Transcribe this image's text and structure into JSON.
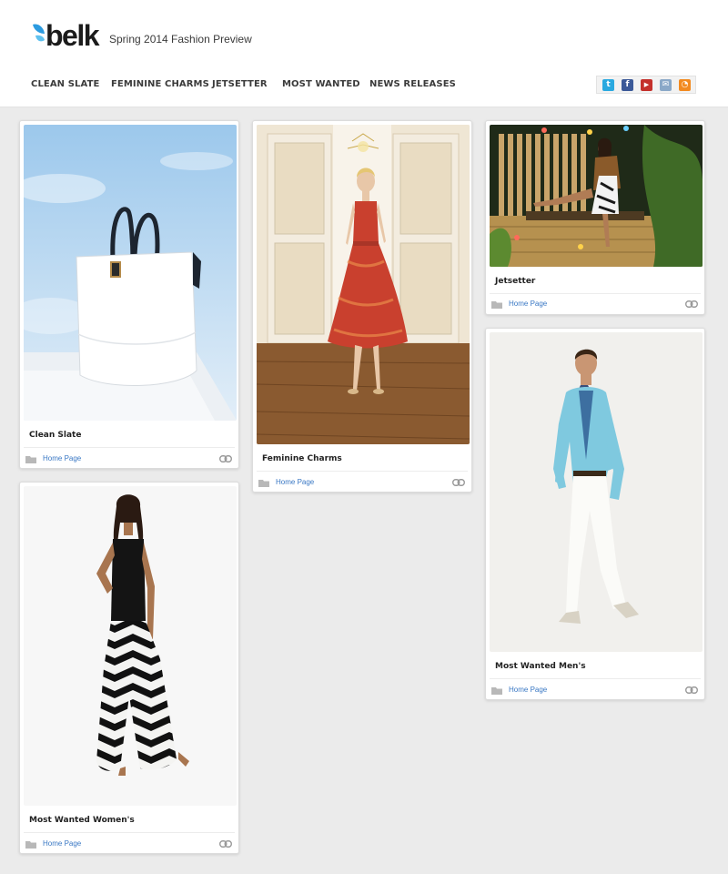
{
  "brand": {
    "logo_text": "belk",
    "tagline": "Spring 2014 Fashion Preview"
  },
  "nav": {
    "items": [
      {
        "label": "CLEAN SLATE"
      },
      {
        "label": "FEMININE CHARMS"
      },
      {
        "label": "JETSETTER"
      },
      {
        "label": "MOST WANTED"
      },
      {
        "label": "NEWS RELEASES"
      }
    ]
  },
  "social": {
    "icons": [
      {
        "name": "twitter-icon",
        "color": "#2aa9e0",
        "glyph": "t"
      },
      {
        "name": "facebook-icon",
        "color": "#3b5998",
        "glyph": "f"
      },
      {
        "name": "youtube-icon",
        "color": "#c4302b",
        "glyph": "▶"
      },
      {
        "name": "email-icon",
        "color": "#8aa8c8",
        "glyph": "✉"
      },
      {
        "name": "rss-icon",
        "color": "#f28a20",
        "glyph": "◔"
      }
    ]
  },
  "cards": [
    {
      "title": "Clean Slate",
      "link": "Home Page",
      "image": "white-tote-bag-photo"
    },
    {
      "title": "Feminine Charms",
      "link": "Home Page",
      "image": "red-floral-dress-photo"
    },
    {
      "title": "Jetsetter",
      "link": "Home Page",
      "image": "woman-on-bamboo-bench-photo"
    },
    {
      "title": "Most Wanted Women's",
      "link": "Home Page",
      "image": "chevron-maxi-skirt-photo"
    },
    {
      "title": "Most Wanted Men's",
      "link": "Home Page",
      "image": "light-blue-blazer-photo"
    }
  ]
}
